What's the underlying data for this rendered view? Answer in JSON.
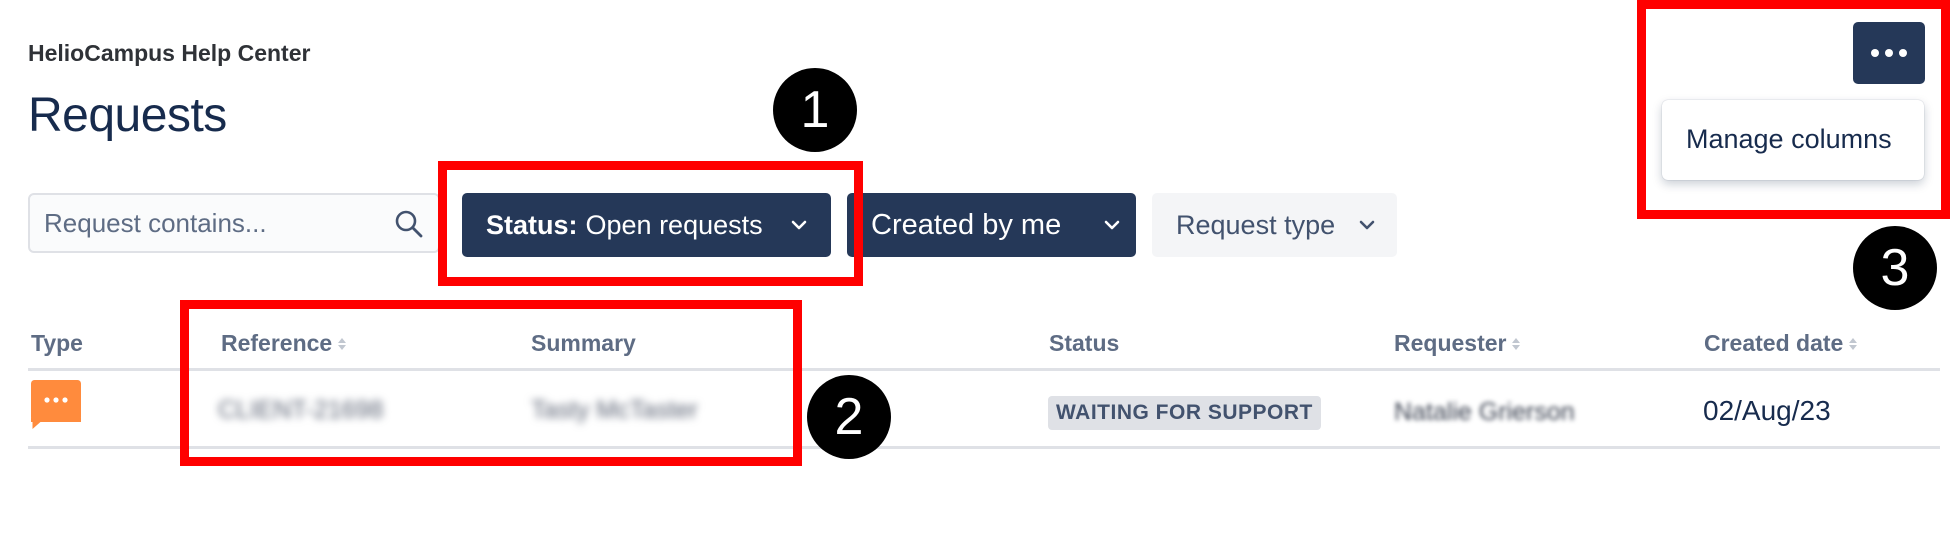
{
  "header": {
    "portal_name": "HelioCampus Help Center",
    "page_title": "Requests"
  },
  "search": {
    "placeholder": "Request contains...",
    "value": ""
  },
  "filters": {
    "status_prefix": "Status:",
    "status_value": "Open requests",
    "created_by": "Created by me",
    "request_type": "Request type"
  },
  "menu": {
    "manage_columns": "Manage columns"
  },
  "table": {
    "columns": [
      "Type",
      "Reference",
      "Summary",
      "Status",
      "Requester",
      "Created date"
    ],
    "rows": [
      {
        "type_icon": "chat-bubble-icon",
        "reference": "CLIENT-21698",
        "summary": "Tasty McTaster",
        "status": "WAITING FOR SUPPORT",
        "requester": "Natalie Grierson",
        "created_date": "02/Aug/23"
      }
    ]
  },
  "annotations": {
    "callouts": [
      "1",
      "2",
      "3"
    ]
  },
  "colors": {
    "primary_button": "#253858",
    "title_text": "#172b4d",
    "header_text": "#5e6c84",
    "type_icon": "#ff8b3d",
    "highlight": "#ff0000",
    "status_badge_bg": "#dfe1e6"
  }
}
